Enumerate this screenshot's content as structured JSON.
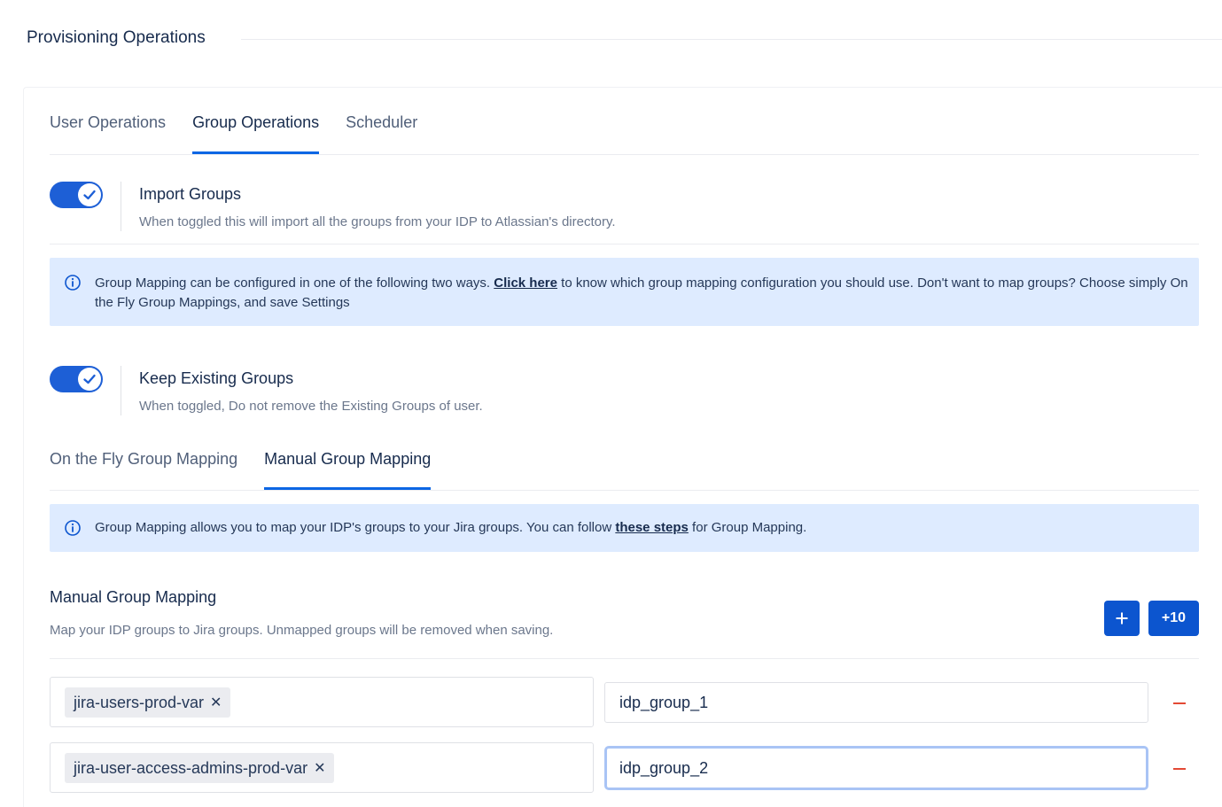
{
  "page": {
    "title": "Provisioning Operations"
  },
  "tabs": [
    {
      "label": "User Operations"
    },
    {
      "label": "Group Operations"
    },
    {
      "label": "Scheduler"
    }
  ],
  "active_tab": "Group Operations",
  "import_groups": {
    "title": "Import Groups",
    "description": "When toggled this will import all the groups from your IDP to Atlassian's directory.",
    "enabled": true
  },
  "info_banner_1": {
    "before_link": "Group Mapping can be configured in one of the following two ways. ",
    "link": "Click here",
    "after_link": " to know which group mapping configuration you should use. Don't want to map groups? Choose simply On the Fly Group Mappings, and save Settings"
  },
  "keep_existing_groups": {
    "title": "Keep Existing Groups",
    "description": "When toggled, Do not remove the Existing Groups of user.",
    "enabled": true
  },
  "mapping_tabs": [
    {
      "label": "On the Fly Group Mapping"
    },
    {
      "label": "Manual Group Mapping"
    }
  ],
  "active_mapping_tab": "Manual Group Mapping",
  "info_banner_2": {
    "before_link": "Group Mapping allows you to map your IDP's groups to your Jira groups. You can follow ",
    "link": "these steps",
    "after_link": " for Group Mapping."
  },
  "manual_mapping": {
    "title": "Manual Group Mapping",
    "description": "Map your IDP groups to Jira groups. Unmapped groups will be removed when saving.",
    "add_label": "+",
    "add_ten_label": "+10",
    "rows": [
      {
        "jira_group": "jira-users-prod-var",
        "idp_group": "idp_group_1"
      },
      {
        "jira_group": "jira-user-access-admins-prod-var",
        "idp_group": "idp_group_2"
      }
    ]
  },
  "colors": {
    "accent": "#0c66e4",
    "toggle_on": "#1d5fd6",
    "button": "#0c55cf",
    "info_bg": "#deebff",
    "remove": "#e34935"
  },
  "icons": {
    "toggle_knob": "check-icon",
    "info": "info-icon",
    "chip_remove": "close-icon",
    "row_remove": "minus-icon"
  }
}
